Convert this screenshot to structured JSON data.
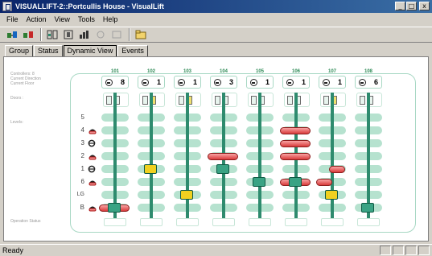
{
  "window": {
    "title": "VISUALLIFT-2::Portcullis House - VisualLift",
    "buttons": [
      "_",
      "□",
      "x"
    ]
  },
  "menu": [
    "File",
    "Action",
    "View",
    "Tools",
    "Help"
  ],
  "toolbar": {
    "icons": [
      "connect-icon",
      "disconnect-icon",
      "group-icon",
      "lift-icon",
      "lift-stats-icon",
      "disabled-icon",
      "blank-icon",
      "folder-icon"
    ]
  },
  "tabs": [
    "Group",
    "Status",
    "Dynamic View",
    "Events"
  ],
  "active_tab": "Dynamic View",
  "side_labels": {
    "controllers": "Controllers: 8",
    "direction": "Current Direction",
    "floor": "Current Floor",
    "doors": "Doors :",
    "levels": "Levels:",
    "operation": "Operation Status"
  },
  "colors": {
    "accent": "#2e8b6e",
    "car": "#3aa384",
    "car_highlight": "#f0d020",
    "call": "#d83a3a",
    "slot": "#b6e2cf",
    "frame": "#a8d8c4"
  },
  "floors": [
    {
      "label": "5",
      "indicator": ""
    },
    {
      "label": "4",
      "indicator": "up"
    },
    {
      "label": "3",
      "indicator": "circle"
    },
    {
      "label": "2",
      "indicator": "up"
    },
    {
      "label": "1",
      "indicator": "circle"
    },
    {
      "label": "6",
      "indicator": "up"
    },
    {
      "label": "LG",
      "indicator": ""
    },
    {
      "label": "B",
      "indicator": "up"
    }
  ],
  "cars": [
    {
      "id": "101",
      "load": "8",
      "door_state": "closed",
      "car_floor": "B",
      "car_color": "green",
      "calls": [
        {
          "floor": "B",
          "side": "wide"
        }
      ]
    },
    {
      "id": "102",
      "load": "1",
      "door_state": "open",
      "car_floor": "1",
      "car_color": "yellow",
      "calls": []
    },
    {
      "id": "103",
      "load": "1",
      "door_state": "open",
      "car_floor": "LG",
      "car_color": "yellow",
      "calls": []
    },
    {
      "id": "104",
      "load": "3",
      "door_state": "closed",
      "car_floor": "1",
      "car_color": "green",
      "calls": [
        {
          "floor": "2",
          "side": "wide"
        }
      ]
    },
    {
      "id": "105",
      "load": "1",
      "door_state": "closed",
      "car_floor": "6",
      "car_color": "green",
      "calls": []
    },
    {
      "id": "106",
      "load": "1",
      "door_state": "closed",
      "car_floor": "6",
      "car_color": "green",
      "calls": [
        {
          "floor": "4",
          "side": "wide"
        },
        {
          "floor": "3",
          "side": "wide"
        },
        {
          "floor": "2",
          "side": "wide"
        },
        {
          "floor": "6",
          "side": "wide"
        }
      ]
    },
    {
      "id": "107",
      "load": "1",
      "door_state": "open",
      "car_floor": "LG",
      "car_color": "yellow",
      "calls": [
        {
          "floor": "1",
          "side": "right"
        },
        {
          "floor": "6",
          "side": "left"
        }
      ]
    },
    {
      "id": "108",
      "load": "6",
      "door_state": "closed",
      "car_floor": "B",
      "car_color": "green",
      "calls": []
    }
  ],
  "statusbar": {
    "text": "Ready"
  }
}
